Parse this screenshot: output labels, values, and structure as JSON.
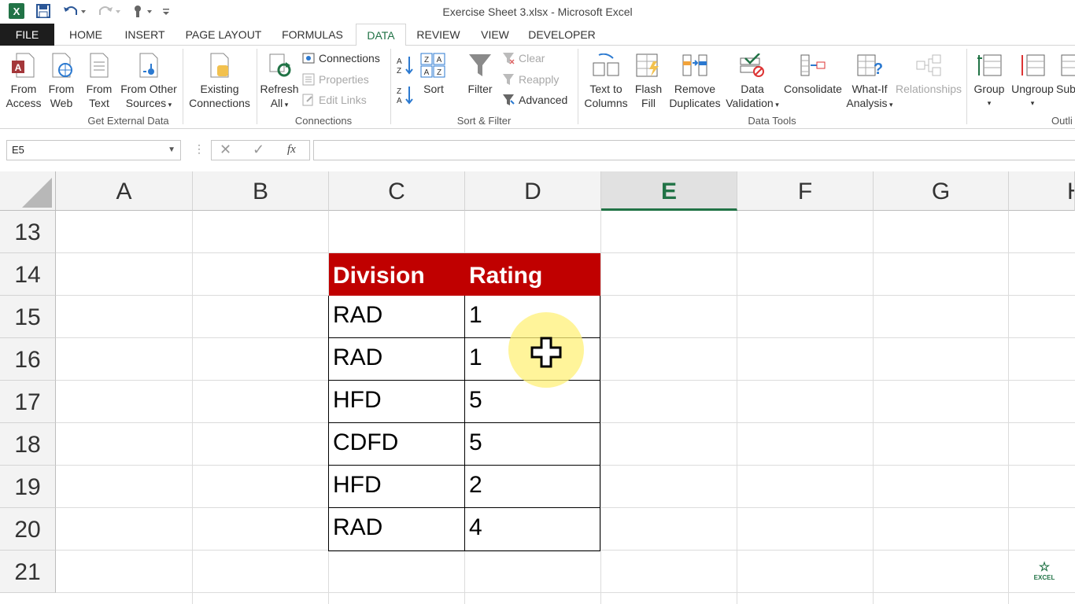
{
  "window": {
    "title": "Exercise Sheet 3.xlsx - Microsoft Excel"
  },
  "tabs": [
    {
      "label": "FILE"
    },
    {
      "label": "HOME"
    },
    {
      "label": "INSERT"
    },
    {
      "label": "PAGE LAYOUT"
    },
    {
      "label": "FORMULAS"
    },
    {
      "label": "DATA"
    },
    {
      "label": "REVIEW"
    },
    {
      "label": "VIEW"
    },
    {
      "label": "DEVELOPER"
    }
  ],
  "ribbon": {
    "get_external": {
      "label": "Get External Data",
      "from_access": [
        "From",
        "Access"
      ],
      "from_web": [
        "From",
        "Web"
      ],
      "from_text": [
        "From",
        "Text"
      ],
      "from_other": [
        "From Other",
        "Sources"
      ],
      "existing": [
        "Existing",
        "Connections"
      ]
    },
    "connections": {
      "label": "Connections",
      "refresh": [
        "Refresh",
        "All"
      ],
      "connections": "Connections",
      "properties": "Properties",
      "edit_links": "Edit Links"
    },
    "sort_filter": {
      "label": "Sort & Filter",
      "sort": "Sort",
      "filter": "Filter",
      "clear": "Clear",
      "reapply": "Reapply",
      "advanced": "Advanced"
    },
    "data_tools": {
      "label": "Data Tools",
      "text_to_columns": [
        "Text to",
        "Columns"
      ],
      "flash_fill": [
        "Flash",
        "Fill"
      ],
      "remove_duplicates": [
        "Remove",
        "Duplicates"
      ],
      "data_validation": [
        "Data",
        "Validation"
      ],
      "consolidate": "Consolidate",
      "what_if": [
        "What-If",
        "Analysis"
      ],
      "relationships": "Relationships"
    },
    "outline": {
      "label": "Outli",
      "group": "Group",
      "ungroup": "Ungroup",
      "subtotal": "Sub"
    }
  },
  "formula_bar": {
    "name_box": "E5",
    "formula": ""
  },
  "grid": {
    "columns": [
      "A",
      "B",
      "C",
      "D",
      "E",
      "F",
      "G",
      "H"
    ],
    "rows": [
      "13",
      "14",
      "15",
      "16",
      "17",
      "18",
      "19",
      "20",
      "21"
    ],
    "active_column": "E",
    "table": {
      "headers": [
        "Division",
        "Rating"
      ],
      "rows": [
        [
          "RAD",
          "1"
        ],
        [
          "RAD",
          "1"
        ],
        [
          "HFD",
          "5"
        ],
        [
          "CDFD",
          "5"
        ],
        [
          "HFD",
          "2"
        ],
        [
          "RAD",
          "4"
        ]
      ]
    }
  },
  "watermark": "EXCEL",
  "colors": {
    "accent": "#217346",
    "header_fill": "#c00000"
  }
}
